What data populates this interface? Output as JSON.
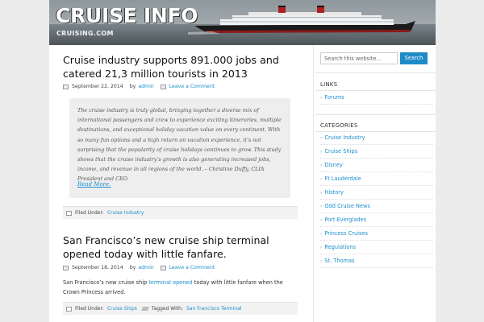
{
  "header": {
    "title": "CRUISE INFO",
    "tagline": "CRUISING.COM"
  },
  "posts": [
    {
      "title": "Cruise industry supports 891.000 jobs and catered 21,3 million tourists in 2013",
      "date": "September 22, 2014",
      "by_label": "by",
      "author": "admin",
      "comment": "Leave a Comment",
      "excerpt": "The cruise industry is truly global, bringing together a diverse mix of international passengers and crew to experience exciting itineraries, multiple destinations, and exceptional holiday vacation value on every continent. With so many fun options and a high return on vacation experience, it’s not surprising that the popularity of cruise holidays continues to grow. This study shows that the cruise industry’s growth is also generating increased jobs, income, and revenue in all regions of the world. – Christine Duffy, CLIA President and CEO.",
      "read_more": "Read More.",
      "filed_label": "Filed Under:",
      "category": "Cruise Industry"
    },
    {
      "title": "San Francisco’s new cruise ship terminal opened today with little fanfare.",
      "date": "September 18, 2014",
      "by_label": "by",
      "author": "admin",
      "comment": "Leave a Comment",
      "body_before": "San Francisco’s new cruise ship ",
      "body_link": "terminal opened",
      "body_after": " today with little fanfare when the Crown Princess arrived.",
      "filed_label": "Filed Under:",
      "category": "Cruise Ships",
      "tagged_label": "Tagged With:",
      "tag": "San Francisco Terminal"
    }
  ],
  "sidebar": {
    "search_placeholder": "Search this website…",
    "search_button": "Search",
    "links_title": "LINKS",
    "links": [
      "Forums"
    ],
    "categories_title": "CATEGORIES",
    "categories": [
      "Cruise Industry",
      "Cruise Ships",
      "Disney",
      "Ft Lauderdale",
      "History",
      "Odd Cruise News",
      "Port Everglades",
      "Princess Cruises",
      "Regulations",
      "St. Thomas"
    ]
  },
  "colors": {
    "link": "#1a8fcc",
    "search_button": "#1e8bc8",
    "page_background": "#ececec"
  }
}
